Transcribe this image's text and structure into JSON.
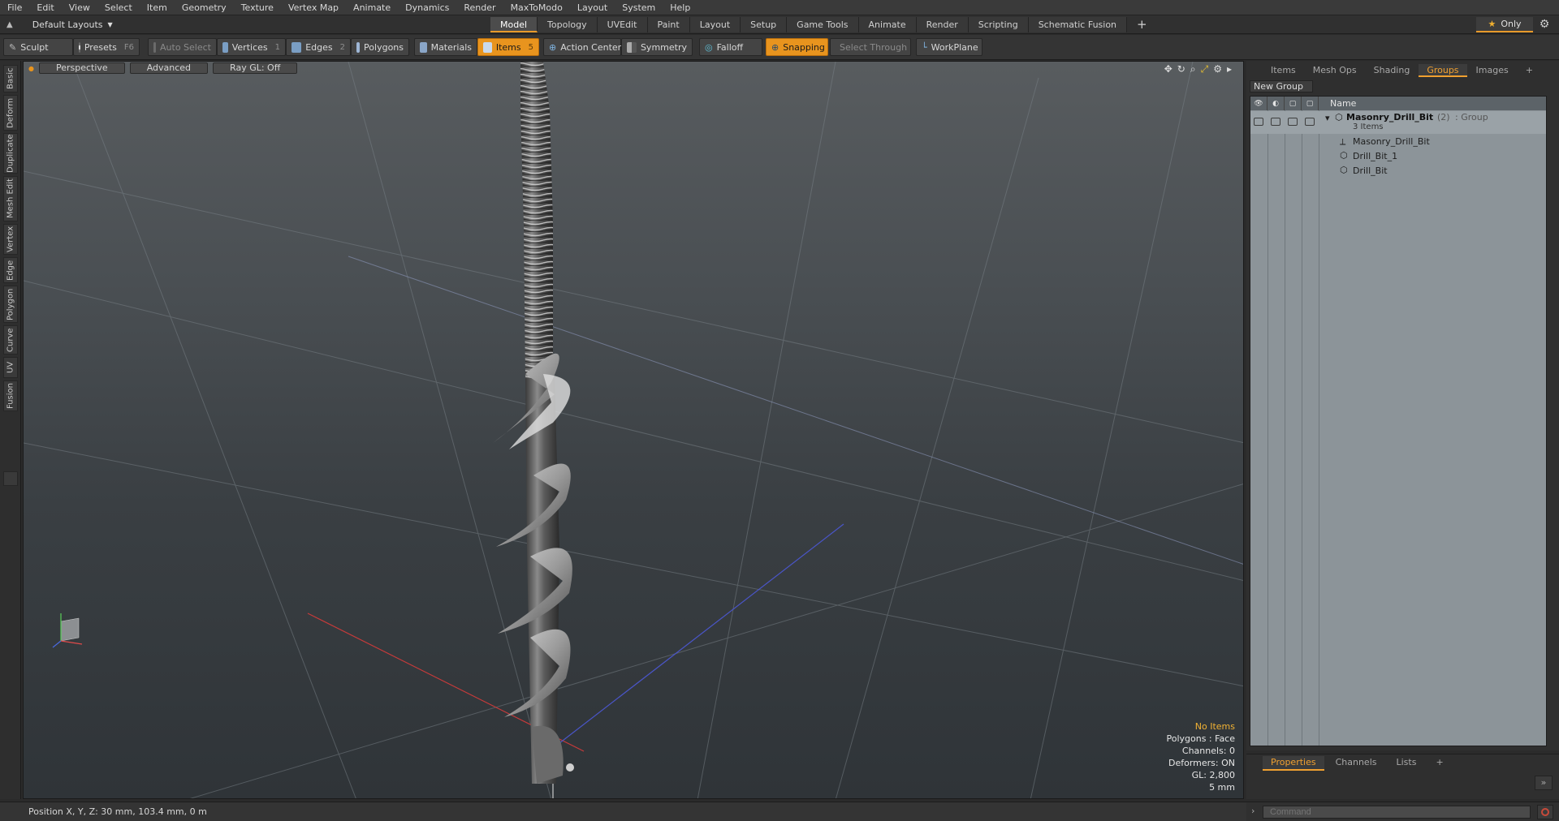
{
  "menu": [
    "File",
    "Edit",
    "View",
    "Select",
    "Item",
    "Geometry",
    "Texture",
    "Vertex Map",
    "Animate",
    "Dynamics",
    "Render",
    "MaxToModo",
    "Layout",
    "System",
    "Help"
  ],
  "layout_dropdown": "Default Layouts",
  "mode_tabs": [
    "Model",
    "Topology",
    "UVEdit",
    "Paint",
    "Layout",
    "Setup",
    "Game Tools",
    "Animate",
    "Render",
    "Scripting",
    "Schematic Fusion"
  ],
  "active_mode": "Model",
  "only_label": "Only",
  "toolbar": {
    "sculpt": "Sculpt",
    "presets": "Presets",
    "presets_key": "F6",
    "auto_select": "Auto Select",
    "vertices": "Vertices",
    "vertices_key": "1",
    "edges": "Edges",
    "edges_key": "2",
    "polygons": "Polygons",
    "materials": "Materials",
    "items": "Items",
    "items_key": "5",
    "action_center": "Action Center",
    "symmetry": "Symmetry",
    "falloff": "Falloff",
    "snapping": "Snapping",
    "select_through": "Select Through",
    "workplane": "WorkPlane"
  },
  "left_tabs": [
    "Basic",
    "Deform",
    "Duplicate",
    "Mesh Edit",
    "Vertex",
    "Edge",
    "Polygon",
    "Curve",
    "UV",
    "Fusion"
  ],
  "viewport": {
    "view": "Perspective",
    "shading": "Advanced",
    "raygl": "Ray GL: Off",
    "info": {
      "items": "No Items",
      "polygons": "Polygons : Face",
      "channels": "Channels: 0",
      "deformers": "Deformers: ON",
      "gl": "GL: 2,800",
      "scale": "5 mm"
    }
  },
  "right_panel": {
    "tabs": [
      "Items",
      "Mesh Ops",
      "Shading",
      "Groups",
      "Images"
    ],
    "active_tab": "Groups",
    "new_group": "New Group",
    "name_header": "Name",
    "group": {
      "name": "Masonry_Drill_Bit",
      "count": "(2)",
      "type": ": Group",
      "items_label": "3 Items",
      "children": [
        "Masonry_Drill_Bit",
        "Drill_Bit_1",
        "Drill_Bit"
      ]
    }
  },
  "props_tabs": [
    "Properties",
    "Channels",
    "Lists"
  ],
  "props_active": "Properties",
  "status": "Position X, Y, Z:  30 mm, 103.4 mm, 0 m",
  "command_placeholder": "Command",
  "colors": {
    "accent": "#e8941e",
    "viewport_top": "#585c5f",
    "viewport_bottom": "#2f3438"
  }
}
